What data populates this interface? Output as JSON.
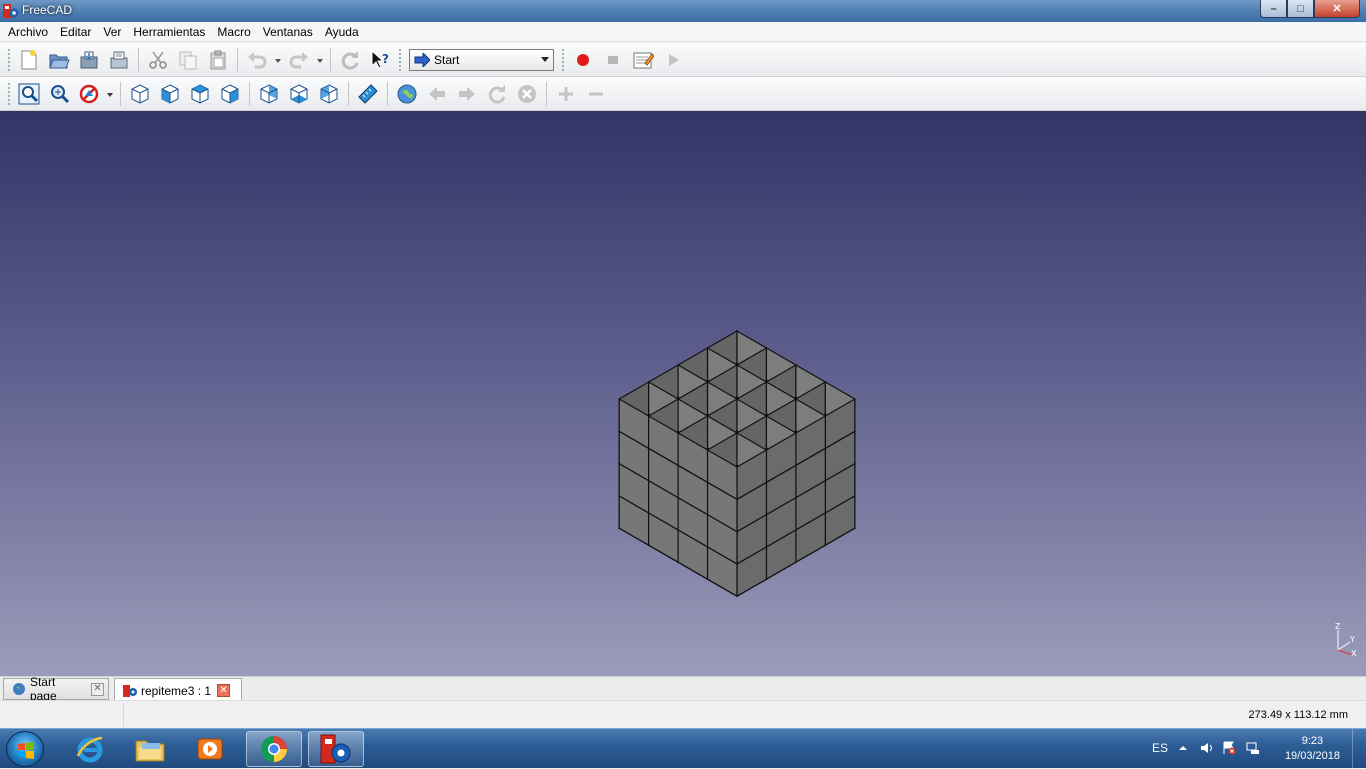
{
  "window": {
    "title": "FreeCAD",
    "controls": {
      "minimize": "–",
      "maximize": "□",
      "close": "✕"
    }
  },
  "menu": [
    "Archivo",
    "Editar",
    "Ver",
    "Herramientas",
    "Macro",
    "Ventanas",
    "Ayuda"
  ],
  "toolbar1": {
    "icons": [
      "new-file-icon",
      "open-file-icon",
      "save-icon",
      "save-as-icon",
      "cut-icon",
      "copy-icon",
      "paste-icon",
      "undo-icon",
      "redo-icon",
      "refresh-icon",
      "whats-this-icon"
    ],
    "workbench": "Start",
    "macro_icons": [
      "record-macro-icon",
      "stop-macro-icon",
      "edit-macro-icon",
      "run-macro-icon"
    ]
  },
  "toolbar2": {
    "icons": [
      "fit-all-icon",
      "fit-selection-icon",
      "draw-style-icon",
      "isometric-view-icon",
      "front-view-icon",
      "top-view-icon",
      "right-view-icon",
      "rear-view-icon",
      "bottom-view-icon",
      "left-view-icon",
      "measure-distance-icon",
      "web-home-icon",
      "back-icon",
      "forward-icon",
      "refresh-page-icon",
      "stop-loading-icon",
      "zoom-in-icon",
      "zoom-out-icon"
    ]
  },
  "axis": {
    "z": "Z",
    "y": "Y",
    "x": "X"
  },
  "tabs": [
    {
      "label": "Start page",
      "icon": "globe-icon",
      "active": false
    },
    {
      "label": "repiteme3 : 1",
      "icon": "freecad-doc-icon",
      "active": true
    }
  ],
  "status": {
    "dimensions": "273.49 x 113.12 mm"
  },
  "taskbar": {
    "apps": [
      "internet-explorer-icon",
      "file-explorer-icon",
      "media-player-icon",
      "chrome-icon",
      "freecad-icon"
    ],
    "language": "ES",
    "time": "9:23",
    "date": "19/03/2018"
  },
  "colors": {
    "view_top": "#333366",
    "view_bottom": "#9b9bbb",
    "model_face": "#777777",
    "model_edge": "#111111"
  }
}
